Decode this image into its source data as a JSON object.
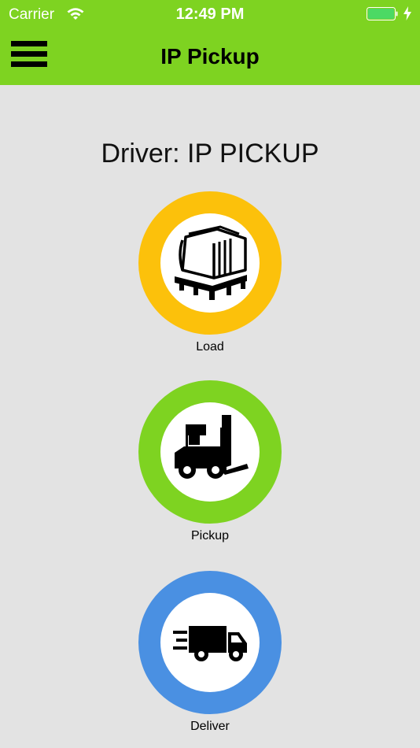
{
  "status_bar": {
    "carrier": "Carrier",
    "time": "12:49 PM",
    "wifi_icon": "wifi-icon",
    "battery_icon": "battery-charging-icon"
  },
  "nav": {
    "title": "IP Pickup",
    "menu_icon": "hamburger-menu-icon"
  },
  "driver_label": "Driver: IP PICKUP",
  "actions": [
    {
      "label": "Load",
      "icon": "pallet-icon",
      "color": "#fcc10b"
    },
    {
      "label": "Pickup",
      "icon": "forklift-icon",
      "color": "#7ed321"
    },
    {
      "label": "Deliver",
      "icon": "delivery-truck-icon",
      "color": "#4a90e2"
    }
  ],
  "colors": {
    "accent_green": "#7ed321",
    "background": "#e3e3e3"
  }
}
